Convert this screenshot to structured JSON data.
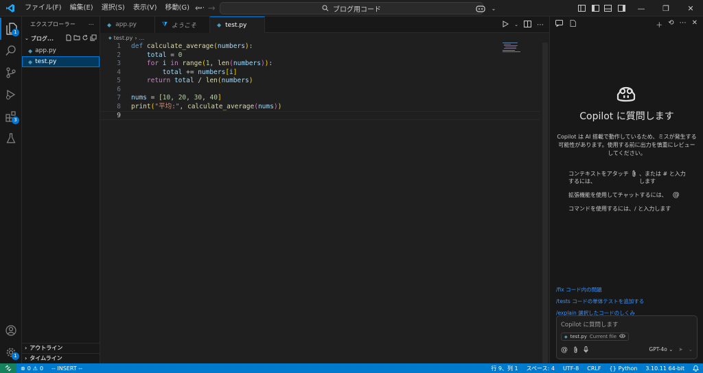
{
  "titlebar": {
    "menus": [
      "ファイル(F)",
      "編集(E)",
      "選択(S)",
      "表示(V)",
      "移動(G)",
      "⋯"
    ],
    "search_text": "ブログ用コード"
  },
  "activity_bar": {
    "explorer_badge": "1",
    "extensions_badge": "3",
    "settings_badge": "1"
  },
  "sidebar": {
    "title": "エクスプローラー",
    "more": "⋯",
    "folder": "ブログ...",
    "files": [
      {
        "name": "app.py",
        "selected": false
      },
      {
        "name": "test.py",
        "selected": true
      }
    ],
    "outline": "アウトライン",
    "timeline": "タイムライン"
  },
  "editor": {
    "tabs": [
      {
        "label": "app.py",
        "active": false,
        "icon": "python-icon"
      },
      {
        "label": "ようこそ",
        "active": false,
        "icon": "vscode-icon"
      },
      {
        "label": "test.py",
        "active": true,
        "icon": "python-icon",
        "dirty": true
      }
    ],
    "breadcrumb": [
      "test.py",
      "..."
    ],
    "line_numbers": [
      "1",
      "2",
      "3",
      "4",
      "5",
      "6",
      "7",
      "8",
      "9"
    ],
    "current_line": 9
  },
  "copilot": {
    "title": "Copilot に質問します",
    "description": "Copilot は AI 搭載で動作しているため、ミスが発生する可能性があります。使用する前に出力を慎重にレビューしてください。",
    "tip_attach_left": "コンテキストをアタッチするには、",
    "tip_attach_right": "、または # と入力します",
    "tip_extension": "拡張機能を使用してチャットするには、",
    "tip_extension_symbol": "@",
    "tip_command": "コマンドを使用するには、/ と入力します",
    "commands": [
      {
        "cmd": "/fix",
        "desc": "コード内の問題"
      },
      {
        "cmd": "/tests",
        "desc": "コードの単体テストを追加する"
      },
      {
        "cmd": "/explain",
        "desc": "選択したコードのしくみ"
      }
    ],
    "input_placeholder": "Copilot に質問します",
    "context_file": "test.py",
    "context_label": "Current file",
    "model": "GPT-4o"
  },
  "statusbar": {
    "errors": "0",
    "warnings": "0",
    "mode": "-- INSERT --",
    "position": "行 9、列 1",
    "spaces": "スペース: 4",
    "encoding": "UTF-8",
    "eol": "CRLF",
    "language": "Python",
    "interpreter": "3.10.11 64-bit"
  },
  "colors": {
    "accent": "#0078d4",
    "statusbar": "#007acc",
    "link": "#3794ff"
  }
}
